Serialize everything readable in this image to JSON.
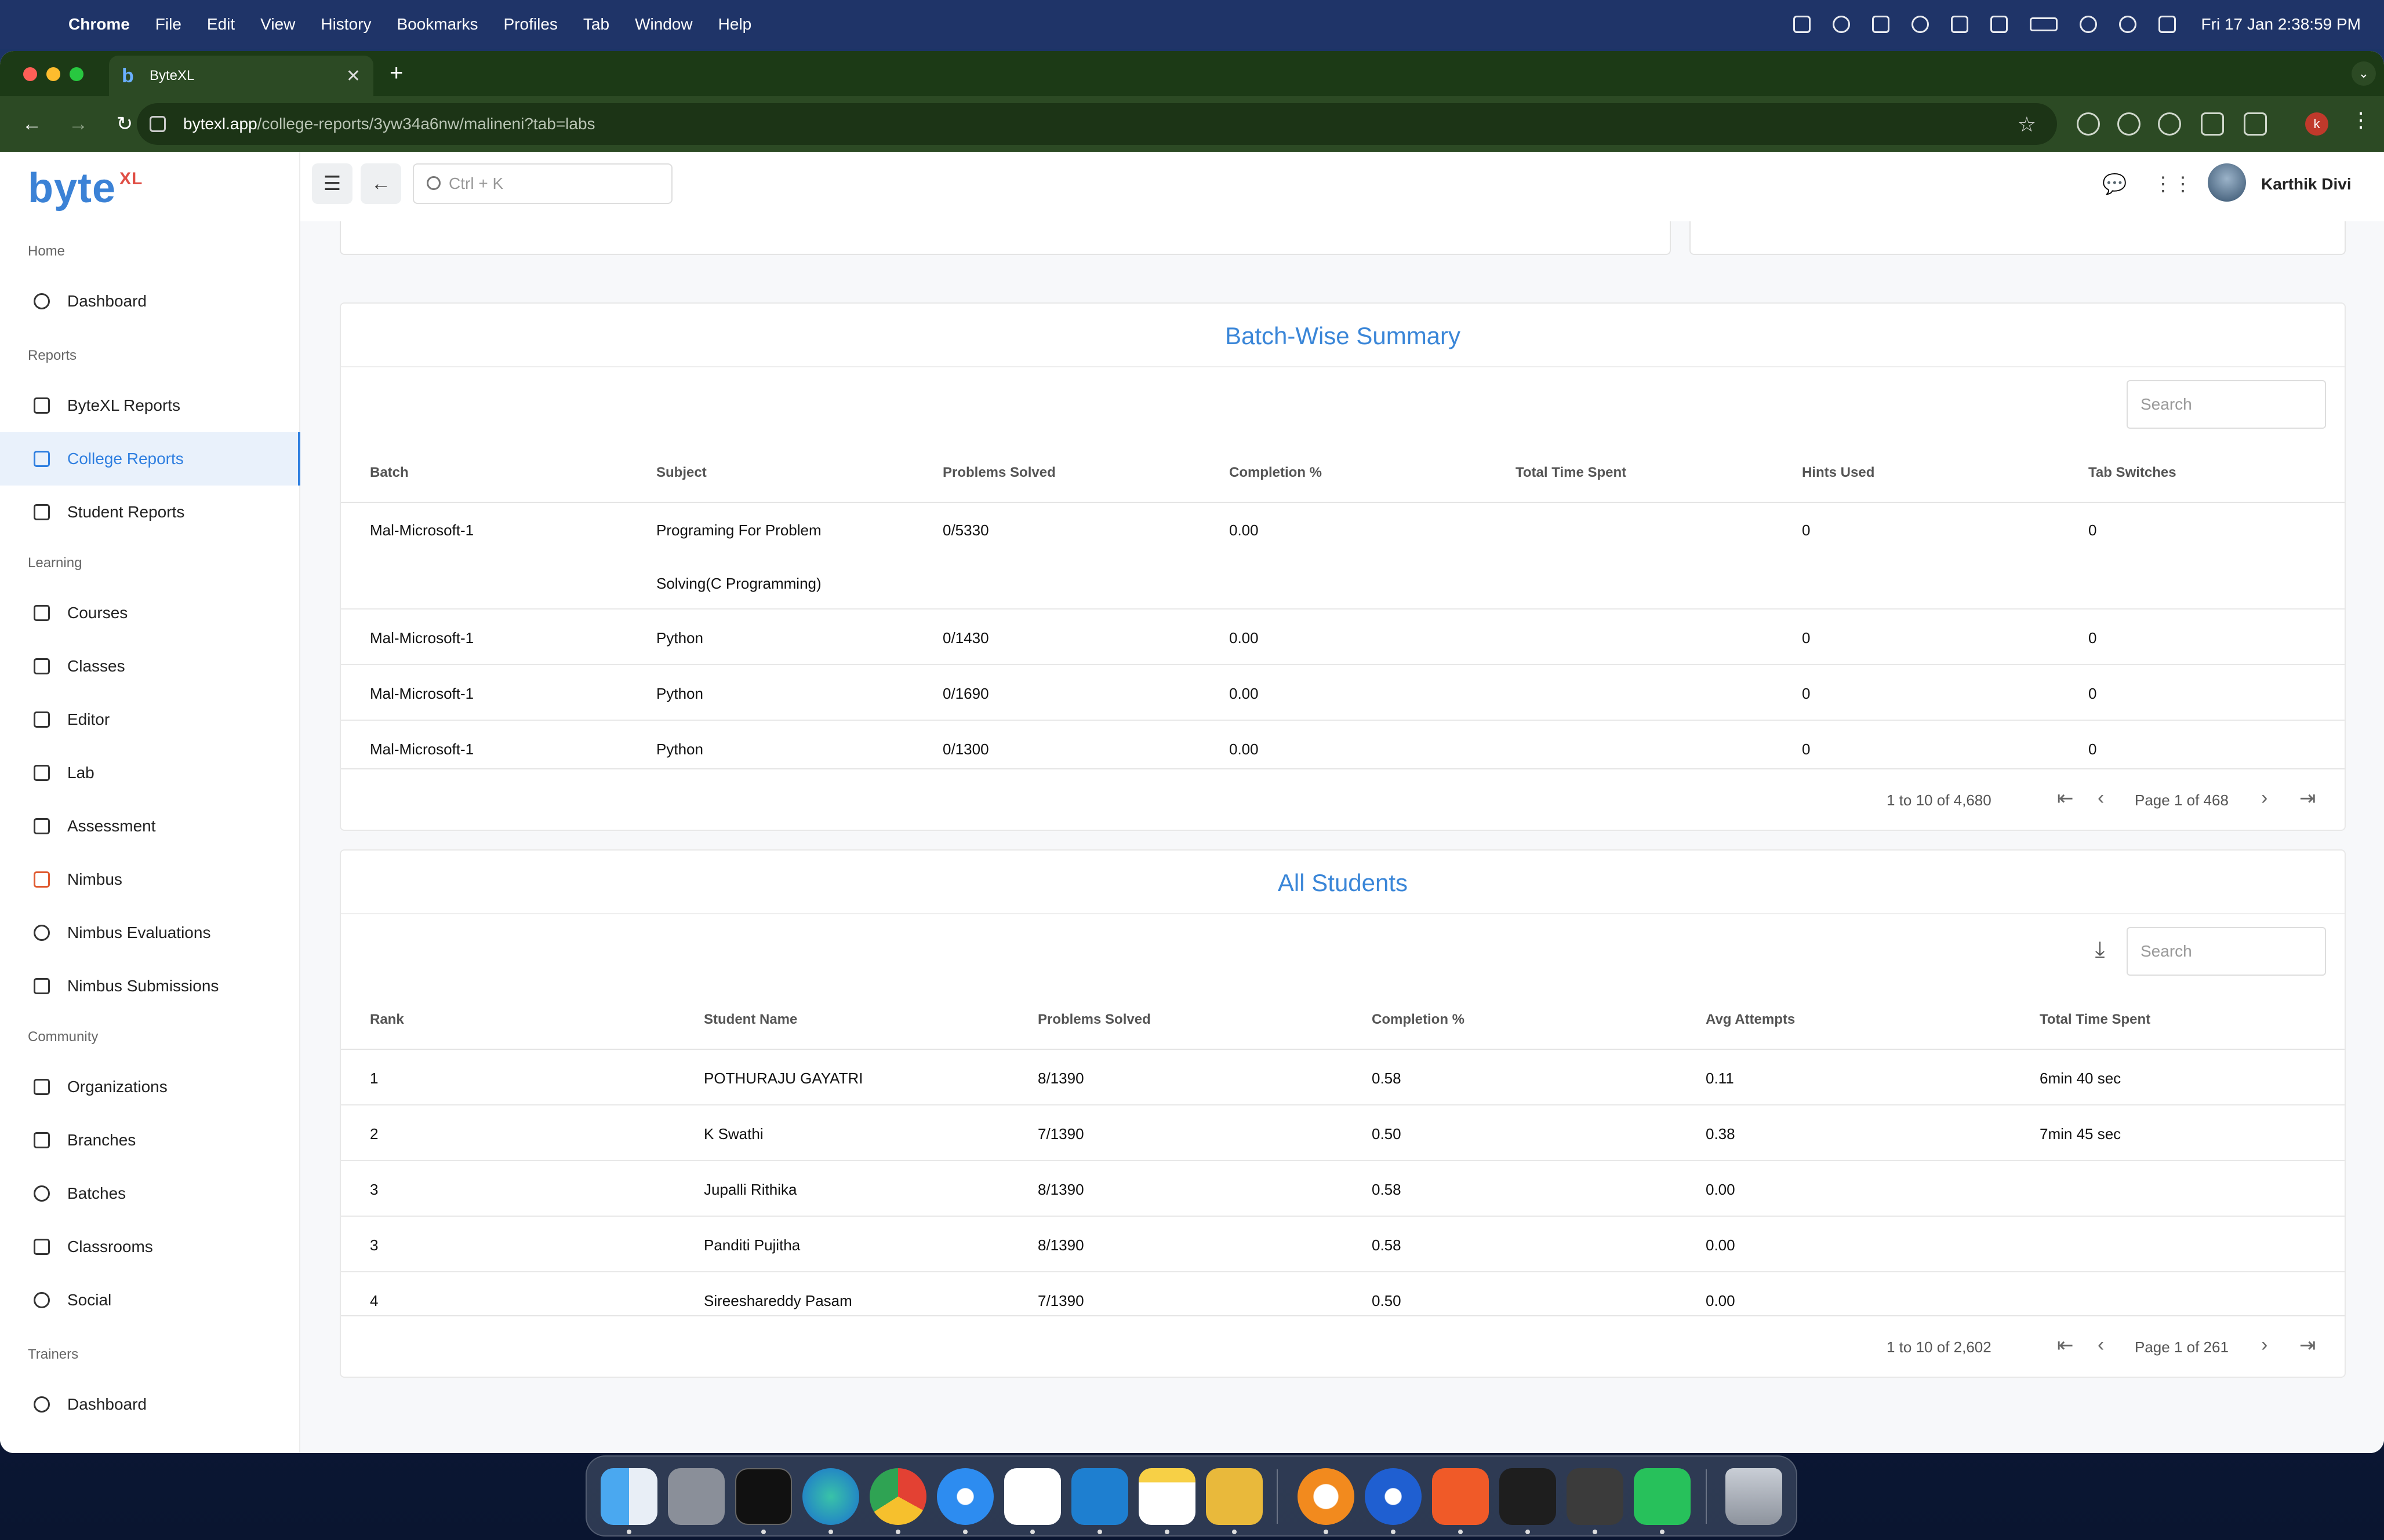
{
  "menubar": {
    "app": "Chrome",
    "items": [
      "File",
      "Edit",
      "View",
      "History",
      "Bookmarks",
      "Profiles",
      "Tab",
      "Window",
      "Help"
    ],
    "clock": "Fri 17 Jan  2:38:59 PM"
  },
  "browser": {
    "tab_title": "ByteXL",
    "url_host": "bytexl.app",
    "url_path": "/college-reports/3yw34a6nw/malineni?tab=labs",
    "profile_initial": "k"
  },
  "sidebar": {
    "logo": "byte",
    "logo_sup": "XL",
    "sections": {
      "home": "Home",
      "reports": "Reports",
      "learning": "Learning",
      "community": "Community",
      "trainers": "Trainers"
    },
    "items": [
      {
        "label": "Dashboard"
      },
      {
        "label": "ByteXL Reports"
      },
      {
        "label": "College Reports"
      },
      {
        "label": "Student Reports"
      },
      {
        "label": "Courses"
      },
      {
        "label": "Classes"
      },
      {
        "label": "Editor"
      },
      {
        "label": "Lab"
      },
      {
        "label": "Assessment"
      },
      {
        "label": "Nimbus"
      },
      {
        "label": "Nimbus Evaluations"
      },
      {
        "label": "Nimbus Submissions"
      },
      {
        "label": "Organizations"
      },
      {
        "label": "Branches"
      },
      {
        "label": "Batches"
      },
      {
        "label": "Classrooms"
      },
      {
        "label": "Social"
      },
      {
        "label": "Dashboard"
      }
    ]
  },
  "topbar": {
    "search_placeholder": "Ctrl + K",
    "user_name": "Karthik Divi"
  },
  "batch_summary": {
    "title": "Batch-Wise Summary",
    "search_placeholder": "Search",
    "columns": [
      "Batch",
      "Subject",
      "Problems Solved",
      "Completion %",
      "Total Time Spent",
      "Hints Used",
      "Tab Switches"
    ],
    "rows": [
      {
        "batch": "Mal-Microsoft-1",
        "subject_l1": "Programing For Problem",
        "subject_l2": "Solving(C Programming)",
        "solved": "0/5330",
        "completion": "0.00",
        "time": "",
        "hints": "0",
        "tabs": "0"
      },
      {
        "batch": "Mal-Microsoft-1",
        "subject": "Python",
        "solved": "0/1430",
        "completion": "0.00",
        "time": "",
        "hints": "0",
        "tabs": "0"
      },
      {
        "batch": "Mal-Microsoft-1",
        "subject": "Python",
        "solved": "0/1690",
        "completion": "0.00",
        "time": "",
        "hints": "0",
        "tabs": "0"
      },
      {
        "batch": "Mal-Microsoft-1",
        "subject": "Python",
        "solved": "0/1300",
        "completion": "0.00",
        "time": "",
        "hints": "0",
        "tabs": "0"
      }
    ],
    "range": "1 to 10 of 4,680",
    "page": "Page 1 of 468"
  },
  "all_students": {
    "title": "All Students",
    "search_placeholder": "Search",
    "columns": [
      "Rank",
      "Student Name",
      "Problems Solved",
      "Completion %",
      "Avg Attempts",
      "Total Time Spent"
    ],
    "rows": [
      {
        "rank": "1",
        "name": "POTHURAJU GAYATRI",
        "solved": "8/1390",
        "completion": "0.58",
        "attempts": "0.11",
        "time": "6min 40 sec"
      },
      {
        "rank": "2",
        "name": "K Swathi",
        "solved": "7/1390",
        "completion": "0.50",
        "attempts": "0.38",
        "time": "7min 45 sec"
      },
      {
        "rank": "3",
        "name": "Jupalli Rithika",
        "solved": "8/1390",
        "completion": "0.58",
        "attempts": "0.00",
        "time": ""
      },
      {
        "rank": "3",
        "name": "Panditi Pujitha",
        "solved": "8/1390",
        "completion": "0.58",
        "attempts": "0.00",
        "time": ""
      },
      {
        "rank": "4",
        "name": "Sireeshareddy Pasam",
        "solved": "7/1390",
        "completion": "0.50",
        "attempts": "0.00",
        "time": ""
      }
    ],
    "range": "1 to 10 of 2,602",
    "page": "Page 1 of 261"
  },
  "colors": {
    "accent": "#3a86d8",
    "browser_frame": "#2c4a24",
    "menubar": "#1f3468"
  }
}
